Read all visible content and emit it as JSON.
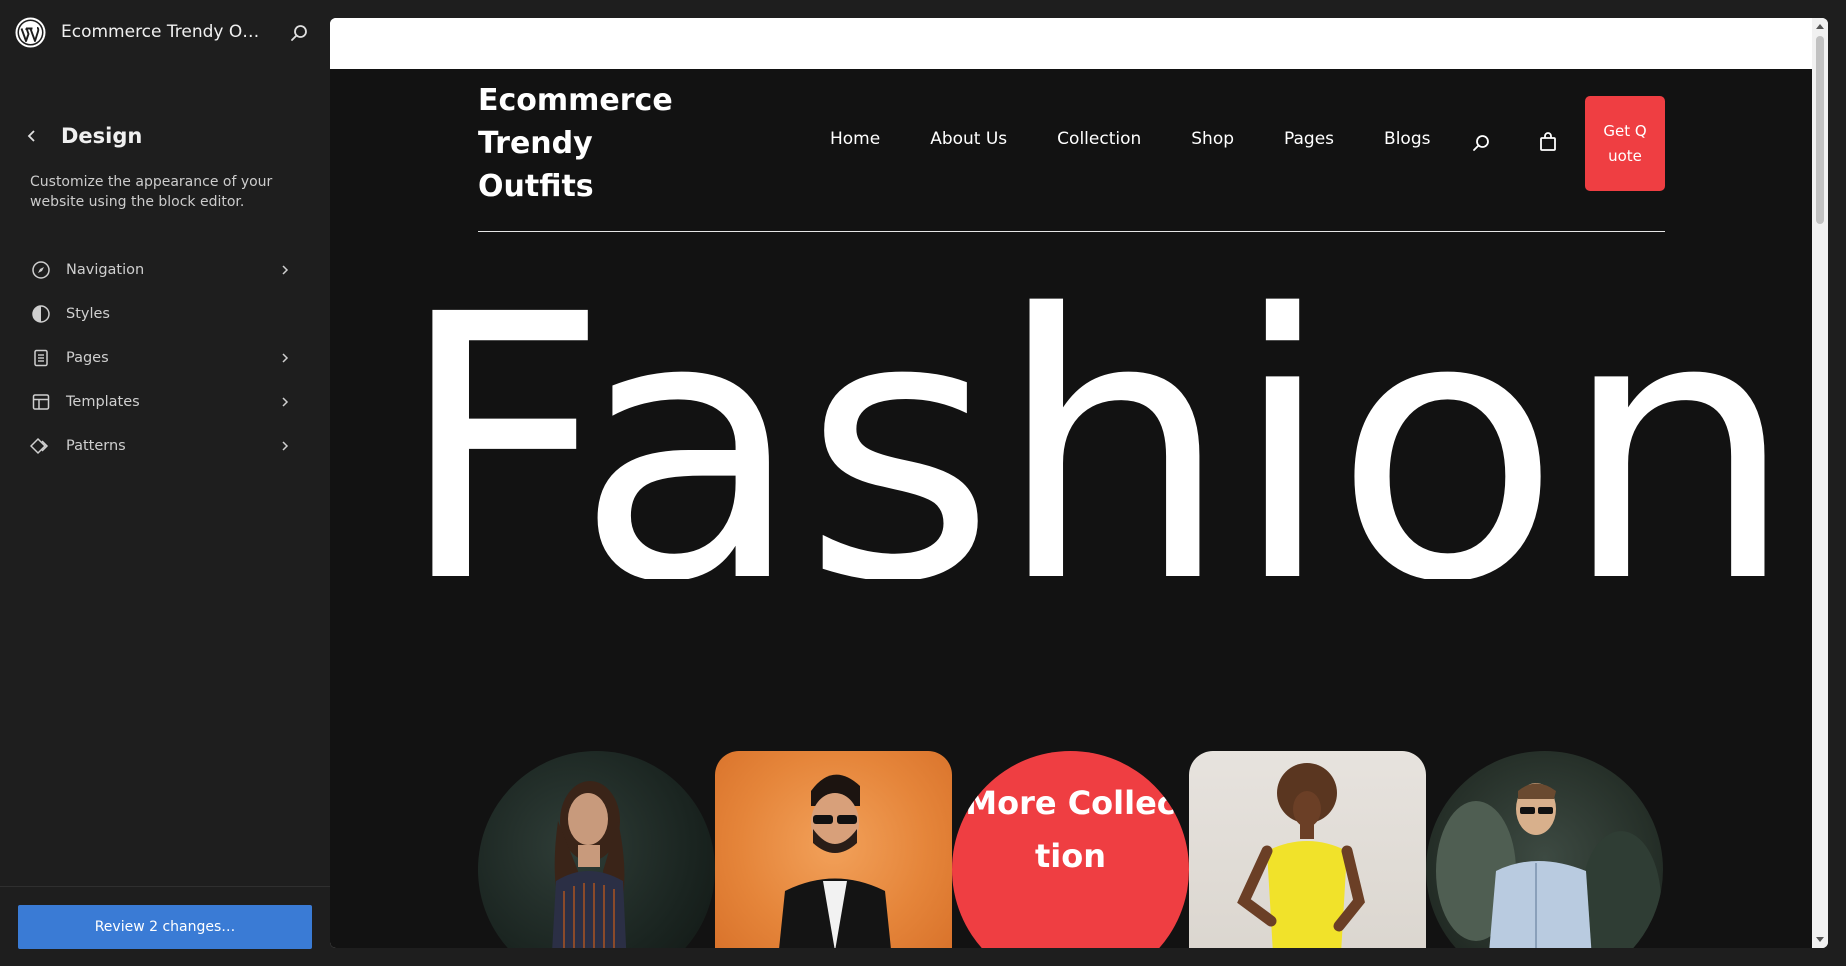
{
  "sidebar": {
    "site_title": "Ecommerce Trendy Out…",
    "panel_title": "Design",
    "description": "Customize the appearance of your website using the block editor.",
    "menu": [
      {
        "label": "Navigation",
        "icon": "navigation-icon",
        "has_chevron": true
      },
      {
        "label": "Styles",
        "icon": "styles-icon",
        "has_chevron": false
      },
      {
        "label": "Pages",
        "icon": "pages-icon",
        "has_chevron": true
      },
      {
        "label": "Templates",
        "icon": "templates-icon",
        "has_chevron": true
      },
      {
        "label": "Patterns",
        "icon": "patterns-icon",
        "has_chevron": true
      }
    ],
    "review_button": "Review 2 changes…"
  },
  "site": {
    "brand": "Ecommerce Trendy Outfits",
    "nav": [
      "Home",
      "About Us",
      "Collection",
      "Shop",
      "Pages",
      "Blogs"
    ],
    "quote_button": "Get Quote",
    "hero_word": "Fashion",
    "more_collection": "More Collection",
    "accent_color": "#ef3e42",
    "background_color": "#121212"
  }
}
